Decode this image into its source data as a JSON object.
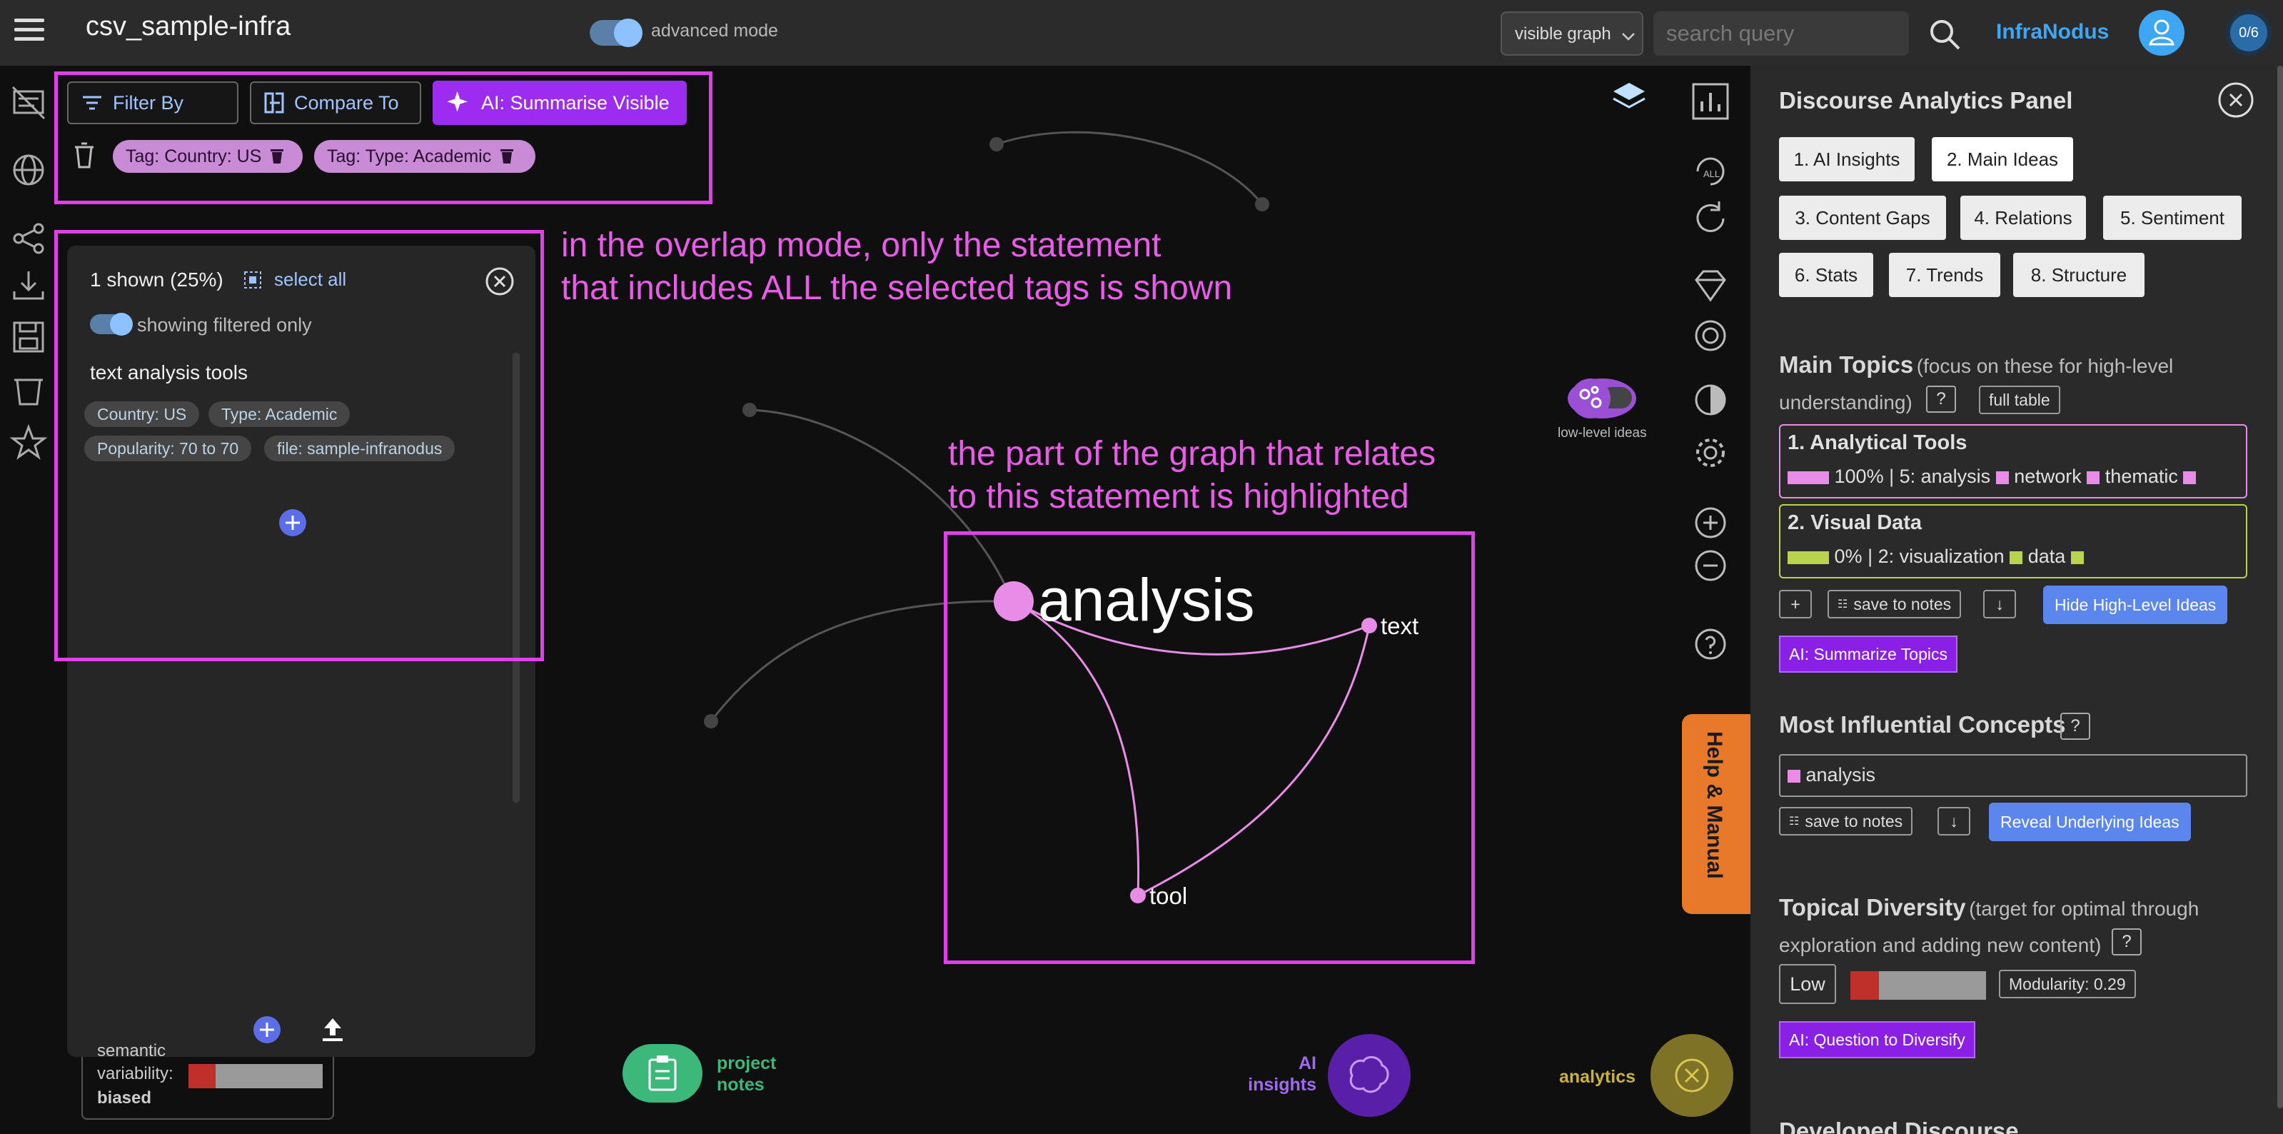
{
  "header": {
    "menu_icon": "hamburger-icon",
    "title": "csv_sample-infra",
    "advanced_mode_label": "advanced mode",
    "advanced_mode_on": true,
    "view_select": "visible graph",
    "search_placeholder": "search query",
    "brand": "InfraNodus",
    "count_badge": "0/6"
  },
  "toolbar": {
    "filter_by": "Filter By",
    "compare_to": "Compare To",
    "ai_summarise": "AI: Summarise Visible",
    "tags": [
      "Tag: Country: US",
      "Tag: Type: Academic"
    ]
  },
  "statements": {
    "shown": "1 shown (25%)",
    "select_all": "select all",
    "showing_filtered": "showing filtered only",
    "items": [
      {
        "text": "text analysis tools",
        "chips": [
          "Country: US",
          "Type: Academic",
          "Popularity: 70 to 70",
          "file: sample-infranodus"
        ]
      }
    ]
  },
  "annotations": {
    "overlap_line1": "in the overlap mode, only the statement",
    "overlap_line2": "that includes ALL the selected tags is shown",
    "graph_line1": "the part of the graph that relates",
    "graph_line2": "to this statement is highlighted"
  },
  "graph": {
    "nodes": [
      {
        "label": "analysis",
        "role": "main"
      },
      {
        "label": "text",
        "role": "secondary"
      },
      {
        "label": "tool",
        "role": "secondary"
      }
    ],
    "low_level_ideas": "low-level ideas",
    "highlight_color": "#e88ce8"
  },
  "bottom": {
    "semantic_label1": "semantic",
    "semantic_label2": "variability:",
    "semantic_value": "biased",
    "project_notes": [
      "project",
      "notes"
    ],
    "ai_insights": [
      "AI",
      "insights"
    ],
    "analytics": "analytics",
    "help_manual": "Help & Manual"
  },
  "panel": {
    "title": "Discourse Analytics Panel",
    "tabs": [
      "1. AI Insights",
      "2. Main Ideas",
      "3. Content Gaps",
      "4. Relations",
      "5. Sentiment",
      "6. Stats",
      "7. Trends",
      "8. Structure"
    ],
    "active_tab": "2. Main Ideas",
    "main_topics_title": "Main Topics",
    "main_topics_sub": "(focus on these for high-level understanding)",
    "q": "?",
    "full_table": "full table",
    "topics": [
      {
        "title": "1. Analytical Tools",
        "pct": "100%",
        "line": "| 5: analysis",
        "words": [
          "network",
          "thematic"
        ],
        "color": "#e88ce8"
      },
      {
        "title": "2. Visual Data",
        "pct": "0%",
        "line": "| 2: visualization",
        "words": [
          "data"
        ],
        "color": "#b8d44c"
      }
    ],
    "plus": "+",
    "save_to_notes": "save to notes",
    "download": "↓",
    "hide_high_level": "Hide High-Level Ideas",
    "ai_summarize_topics": "AI: Summarize Topics",
    "influential_title": "Most Influential Concepts",
    "influential_items": [
      "analysis"
    ],
    "reveal_underlying": "Reveal Underlying Ideas",
    "diversity_title": "Topical Diversity",
    "diversity_sub": "(target for optimal through exploration and adding new content)",
    "diversity_level": "Low",
    "modularity": "Modularity: 0.29",
    "ai_question": "AI: Question to Diversify",
    "cut_heading": "Developed Discourse"
  },
  "colors": {
    "accent_purple": "#9b2cf0",
    "accent_blue": "#3ea7f5",
    "annotation": "#e85ce8",
    "help_orange": "#e8782a"
  }
}
